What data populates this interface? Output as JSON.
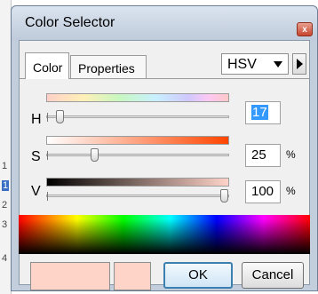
{
  "dialog": {
    "title": "Color Selector",
    "close_glyph": "x"
  },
  "tabs": [
    {
      "label": "Color",
      "active": true
    },
    {
      "label": "Properties",
      "active": false
    }
  ],
  "mode_select": {
    "value": "HSV"
  },
  "sliders": [
    {
      "label": "H",
      "value": "17",
      "selected": true,
      "unit": "",
      "fraction": 0.05
    },
    {
      "label": "S",
      "value": "25",
      "selected": false,
      "unit": "%",
      "fraction": 0.25
    },
    {
      "label": "V",
      "value": "100",
      "selected": false,
      "unit": "%",
      "fraction": 1.0
    }
  ],
  "gradients": {
    "hue": "linear-gradient(to right, #ffd0c8, #fff0b8 20%, #c8f7c0 40%, #c8f0ff 60%, #d0c8ff 78%, #ffc8f0 90%, #ffc8c8)",
    "saturation": "linear-gradient(to right, #ffffff, #ff4500)",
    "value": "linear-gradient(to right, #000000, #ffd4c8)"
  },
  "swatches": {
    "new_color": "#ffd4c8",
    "old_color": "#ffd4c8"
  },
  "buttons": {
    "ok": "OK",
    "cancel": "Cancel"
  },
  "background": {
    "edge_numbers": [
      "1",
      "1",
      "2",
      "3",
      "4"
    ]
  }
}
